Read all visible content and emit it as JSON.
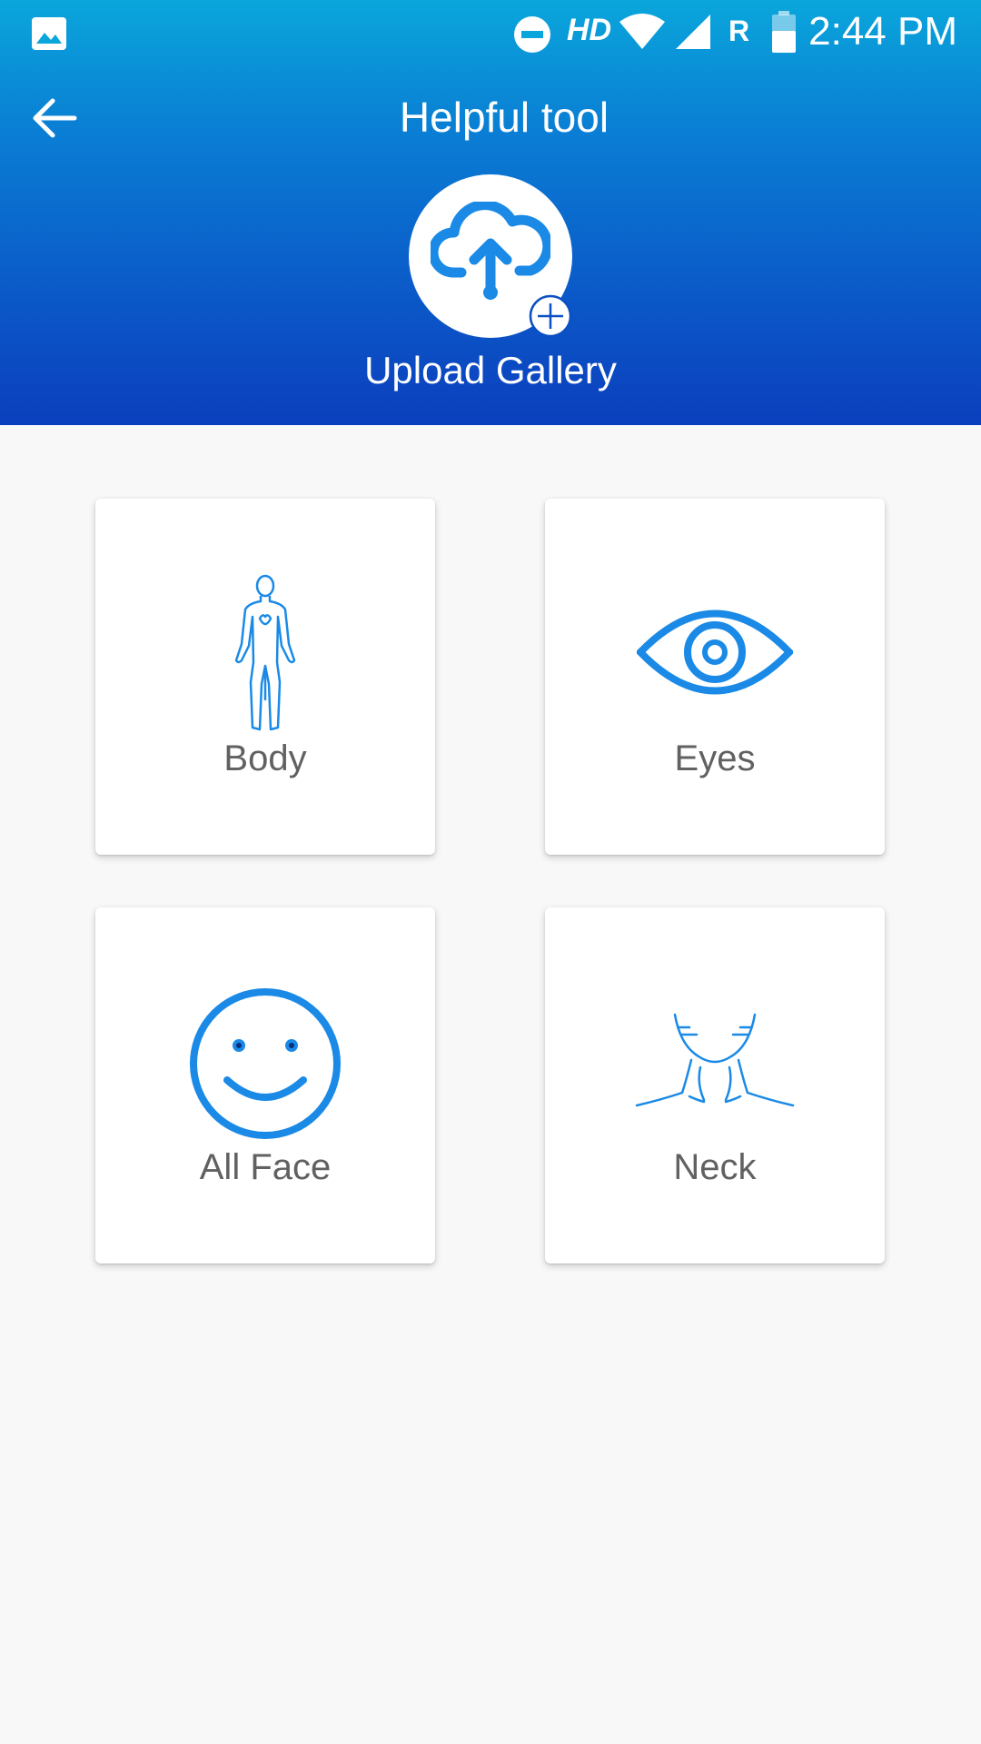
{
  "status_bar": {
    "hd": "HD",
    "roaming": "R",
    "time": "2:44 PM",
    "icons": [
      "gallery-icon",
      "do-not-disturb-icon",
      "wifi-icon",
      "signal-icon",
      "battery-icon"
    ]
  },
  "header": {
    "title": "Helpful tool",
    "back_icon": "arrow-left-icon",
    "upload_label": "Upload Gallery",
    "upload_icon": "cloud-upload-icon"
  },
  "categories": [
    {
      "label": "Body",
      "icon": "human-body-icon"
    },
    {
      "label": "Eyes",
      "icon": "eye-icon"
    },
    {
      "label": "All Face",
      "icon": "smiley-face-icon"
    },
    {
      "label": "Neck",
      "icon": "neck-icon"
    }
  ],
  "colors": {
    "header_top": "#0aa6db",
    "header_bottom": "#0b3fbd",
    "icon_blue": "#1a8ae6",
    "label_gray": "#616161",
    "background": "#f8f8f8"
  }
}
